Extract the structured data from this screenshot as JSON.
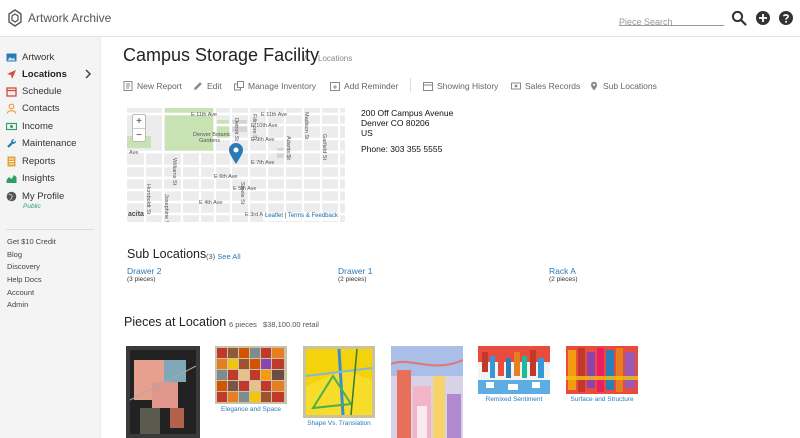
{
  "app": {
    "name": "Artwork Archive"
  },
  "search": {
    "placeholder": "Piece Search"
  },
  "sidebar": {
    "items": [
      {
        "label": "Artwork"
      },
      {
        "label": "Locations"
      },
      {
        "label": "Schedule"
      },
      {
        "label": "Contacts"
      },
      {
        "label": "Income"
      },
      {
        "label": "Maintenance"
      },
      {
        "label": "Reports"
      },
      {
        "label": "Insights"
      },
      {
        "label": "My Profile"
      }
    ],
    "profile_status": "Public",
    "secondary": [
      "Get $10 Credit",
      "Blog",
      "Discovery",
      "Help Docs",
      "Account",
      "Admin"
    ]
  },
  "page": {
    "title": "Campus Storage Facility",
    "breadcrumb_sep": "/",
    "breadcrumb": "Locations"
  },
  "toolbar": {
    "new_report": "New Report",
    "edit": "Edit",
    "manage_inventory": "Manage Inventory",
    "add_reminder": "Add Reminder",
    "showing_history": "Showing History",
    "sales_records": "Sales Records",
    "sub_locations": "Sub Locations"
  },
  "map": {
    "zoom_in": "+",
    "zoom_out": "−",
    "attribution_leaflet": "Leaflet",
    "attribution_sep": "|",
    "attribution_terms": "Terms & Feedback",
    "left_label": "acita",
    "streets": [
      "E 11th Ave",
      "E 11th Ave",
      "E 10th Ave",
      "E 9th Ave",
      "Denver Botanic Gardens",
      "E 7th Ave",
      "E 6th Ave",
      "E 5th Ave",
      "E 4th Ave",
      "E 3rd Ave",
      "Ave",
      "Williams St",
      "Humboldt St",
      "Detroit St",
      "Adams St",
      "Madison St",
      "Garfield St",
      "Fillmore St",
      "Steele St",
      "Josephine St"
    ]
  },
  "address": {
    "line1": "200 Off Campus Avenue",
    "line2": "Denver CO 80206",
    "line3": "US",
    "phone": "Phone: 303 355 5555"
  },
  "sub_locations": {
    "heading": "Sub Locations",
    "count": "(3)",
    "see_all": "See All",
    "items": [
      {
        "name": "Drawer 2",
        "count": "(3 pieces)"
      },
      {
        "name": "Drawer 1",
        "count": "(2 pieces)"
      },
      {
        "name": "Rack A",
        "count": "(2 pieces)"
      }
    ]
  },
  "pieces": {
    "heading": "Pieces at Location",
    "count": "6 pieces",
    "retail": "$38,100.00 retail",
    "items": [
      {
        "caption": ""
      },
      {
        "caption": "Elegance and Space"
      },
      {
        "caption": "Shape Vs. Translation"
      },
      {
        "caption": ""
      },
      {
        "caption": "Remixed Sentiment"
      },
      {
        "caption": "Surface and Structure"
      }
    ]
  },
  "colors": {
    "link": "#2a7ab8",
    "sidebar_bg": "#f4f4f4",
    "profile_status": "#2e9e6a",
    "map_marker": "#2a7ab8"
  }
}
